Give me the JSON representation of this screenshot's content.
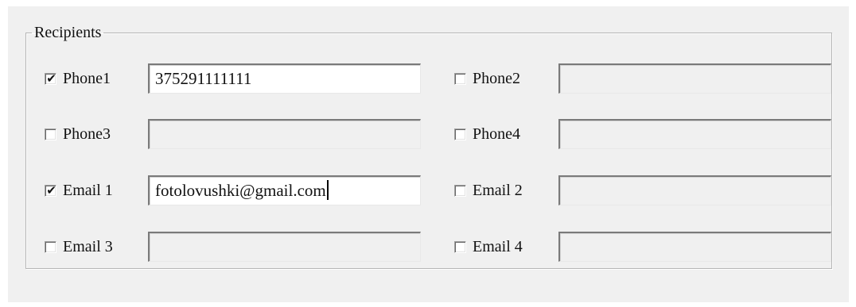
{
  "group": {
    "title": "Recipients"
  },
  "recipients": [
    {
      "label": "Phone1",
      "checked": true,
      "enabled": true,
      "value": "375291111111"
    },
    {
      "label": "Phone2",
      "checked": false,
      "enabled": false,
      "value": ""
    },
    {
      "label": "Phone3",
      "checked": false,
      "enabled": false,
      "value": ""
    },
    {
      "label": "Phone4",
      "checked": false,
      "enabled": false,
      "value": ""
    },
    {
      "label": "Email 1",
      "checked": true,
      "enabled": true,
      "value": "fotolovushki@gmail.com",
      "focused": true
    },
    {
      "label": "Email 2",
      "checked": false,
      "enabled": false,
      "value": ""
    },
    {
      "label": "Email 3",
      "checked": false,
      "enabled": false,
      "value": ""
    },
    {
      "label": "Email 4",
      "checked": false,
      "enabled": false,
      "value": ""
    }
  ],
  "icons": {
    "checkmark": "checkmark-icon"
  }
}
